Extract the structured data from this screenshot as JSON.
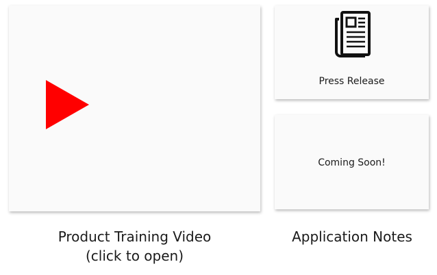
{
  "video": {
    "caption_line1": "Product Training Video",
    "caption_line2": "(click to open)",
    "play_color": "#ff0000"
  },
  "press": {
    "label": "Press Release"
  },
  "notes": {
    "placeholder": "Coming Soon!",
    "caption": "Application Notes"
  }
}
